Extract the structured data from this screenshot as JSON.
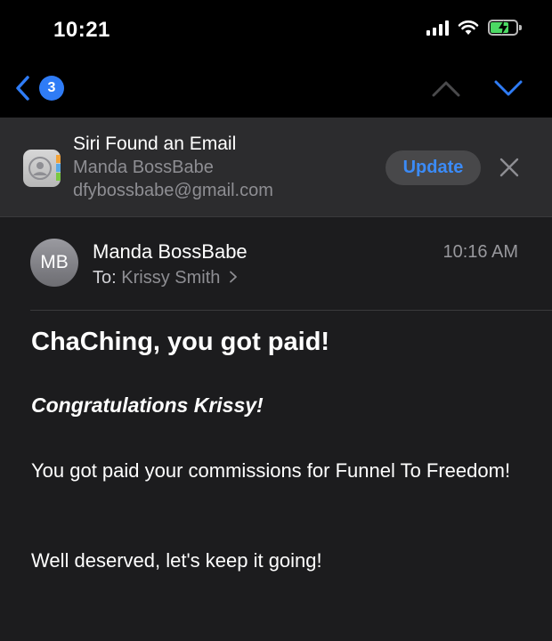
{
  "status_bar": {
    "time": "10:21"
  },
  "nav": {
    "unread_count": "3"
  },
  "siri_banner": {
    "title": "Siri Found an Email",
    "name": "Manda BossBabe",
    "email": "dfybossbabe@gmail.com",
    "update_label": "Update"
  },
  "message": {
    "avatar_initials": "MB",
    "sender": "Manda BossBabe",
    "to_label": "To:",
    "to_name": "Krissy Smith",
    "time": "10:16 AM",
    "subject": "ChaChing, you got paid!",
    "greeting": "Congratulations Krissy!",
    "paragraph_1": "You got paid your commissions for Funnel To Freedom!",
    "paragraph_2": "Well deserved, let's keep it going!"
  },
  "colors": {
    "accent": "#2f7cf6",
    "background": "#1c1c1e",
    "banner": "#2c2c2e"
  },
  "icons": [
    "back-chevron-icon",
    "up-chevron-icon",
    "down-chevron-icon",
    "close-icon",
    "contact-card-icon",
    "signal-icon",
    "wifi-icon",
    "battery-icon"
  ]
}
